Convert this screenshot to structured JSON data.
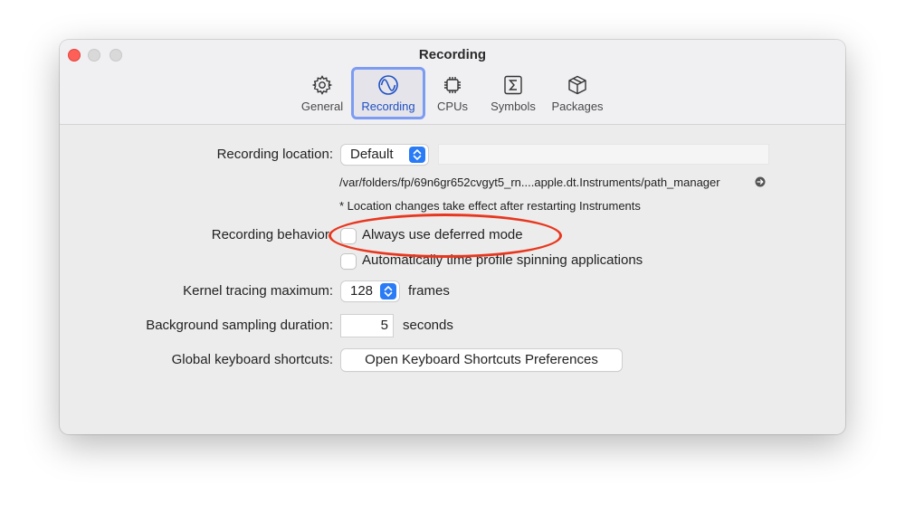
{
  "window": {
    "title": "Recording"
  },
  "tabs": [
    {
      "label": "General",
      "icon": "gear-icon",
      "selected": false
    },
    {
      "label": "Recording",
      "icon": "waveform-icon",
      "selected": true
    },
    {
      "label": "CPUs",
      "icon": "cpu-icon",
      "selected": false
    },
    {
      "label": "Symbols",
      "icon": "sigma-icon",
      "selected": false
    },
    {
      "label": "Packages",
      "icon": "package-box-icon",
      "selected": false
    }
  ],
  "recording_location": {
    "label": "Recording location:",
    "selected_value": "Default",
    "path": "/var/folders/fp/69n6gr652cvgyt5_rn....apple.dt.Instruments/path_manager",
    "note": "* Location changes take effect after restarting Instruments"
  },
  "recording_behavior": {
    "label": "Recording behavior:",
    "options": [
      {
        "label": "Always use deferred mode",
        "checked": false
      },
      {
        "label": "Automatically time profile spinning applications",
        "checked": false
      }
    ]
  },
  "kernel_tracing": {
    "label": "Kernel tracing maximum:",
    "value": "128",
    "unit": "frames"
  },
  "background_sampling": {
    "label": "Background sampling duration:",
    "value": "5",
    "unit": "seconds"
  },
  "keyboard_shortcuts": {
    "label": "Global keyboard shortcuts:",
    "button_label": "Open Keyboard Shortcuts Preferences"
  },
  "colors": {
    "accent": "#2a7bf6",
    "selected_tab_border": "#7c9cf2",
    "annotation": "#e8371f",
    "close_button": "#fe5f57"
  }
}
